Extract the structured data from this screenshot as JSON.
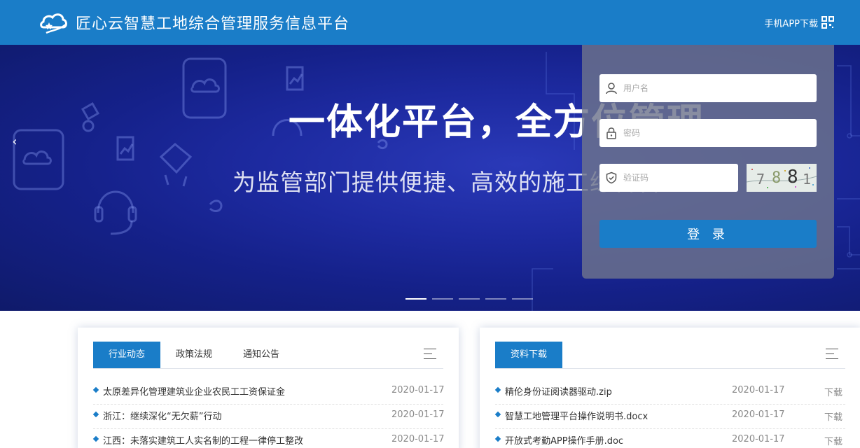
{
  "header": {
    "title": "匠心云智慧工地综合管理服务信息平台",
    "app_download": "手机APP下载"
  },
  "banner": {
    "heading": "一体化平台，全方位管理",
    "subheading": "为监管部门提供便捷、高效的施工综合管理",
    "prev_arrow": "‹",
    "slide_count": 5,
    "active_slide": 1
  },
  "login": {
    "username_placeholder": "用户名",
    "password_placeholder": "密码",
    "captcha_placeholder": "验证码",
    "captcha_text": [
      "7",
      "8",
      "8",
      "1"
    ],
    "submit_label": "登 录"
  },
  "news": {
    "tabs": [
      {
        "label": "行业动态",
        "active": true
      },
      {
        "label": "政策法规",
        "active": false
      },
      {
        "label": "通知公告",
        "active": false
      }
    ],
    "items": [
      {
        "title": "太原差异化管理建筑业企业农民工工资保证金",
        "date": "2020-01-17"
      },
      {
        "title": "浙江：继续深化“无欠薪”行动",
        "date": "2020-01-17"
      },
      {
        "title": "江西：未落实建筑工人实名制的工程一律停工整改",
        "date": "2020-01-17"
      }
    ]
  },
  "downloads": {
    "tabs": [
      {
        "label": "资料下载",
        "active": true
      }
    ],
    "items": [
      {
        "title": "精伦身份证阅读器驱动.zip",
        "date": "2020-01-17",
        "action": "下载"
      },
      {
        "title": "智慧工地管理平台操作说明书.docx",
        "date": "2020-01-17",
        "action": "下载"
      },
      {
        "title": "开放式考勤APP操作手册.doc",
        "date": "2020-01-17",
        "action": "下载"
      }
    ]
  },
  "colors": {
    "primary": "#1a7dc8",
    "banner_dark": "#15218a"
  },
  "icons": {
    "logo": "cloud-star-logo",
    "qr": "qr-code-icon",
    "user": "user-icon",
    "lock": "lock-icon",
    "captcha": "shield-check-icon",
    "menu": "list-menu-icon"
  }
}
